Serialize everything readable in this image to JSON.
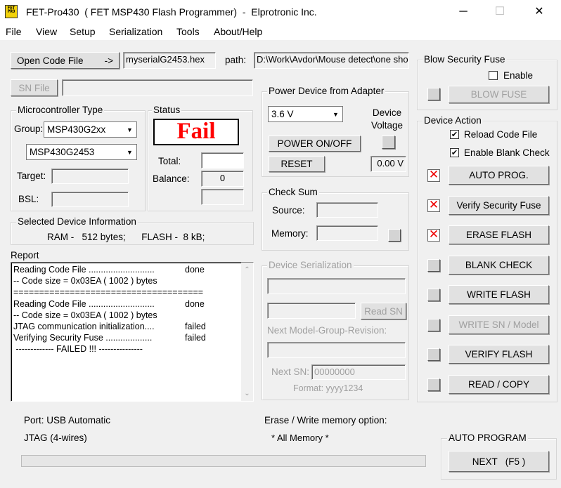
{
  "window": {
    "title": "FET-Pro430  ( FET MSP430 Flash Programmer)  -  Elprotronic Inc.",
    "icon_text": [
      "FET",
      "PRO"
    ],
    "minimize": "─",
    "maximize": "☐",
    "close": "✕"
  },
  "menu": [
    "File",
    "View",
    "Setup",
    "Serialization",
    "Tools",
    "About/Help"
  ],
  "code_file": {
    "open_button": "Open Code File        ->",
    "filename": "myserialG2453.hex",
    "path_label": "path:",
    "path_value": "D:\\Work\\Avdor\\Mouse detect\\one shot\\",
    "sn_file_button": "SN File",
    "sn_file_value": ""
  },
  "microcontroller": {
    "title": "Microcontroller Type",
    "group_label": "Group:",
    "group_value": "MSP430G2xx",
    "device_value": "MSP430G2453",
    "target_label": "Target:",
    "bsl_label": "BSL:"
  },
  "status": {
    "title": "Status",
    "result": "Fail",
    "total_label": "Total:",
    "total_value": "",
    "balance_label": "Balance:",
    "balance_value": "0"
  },
  "power": {
    "title": "Power Device from Adapter",
    "voltage_select": "3.6 V",
    "device_voltage_label": "Device\nVoltage",
    "power_button": "POWER ON/OFF",
    "reset_button": "RESET",
    "measured_voltage": "0.00 V"
  },
  "selected_device": {
    "title": "Selected Device Information",
    "info": "RAM -   512 bytes;      FLASH -  8 kB;"
  },
  "checksum": {
    "title": "Check Sum",
    "source_label": "Source:",
    "memory_label": "Memory:"
  },
  "report": {
    "title": "Report",
    "lines": [
      {
        "text": "Reading Code File ...........................",
        "status": "done"
      },
      {
        "text": "-- Code size = 0x03EA ( 1002 ) bytes",
        "status": ""
      },
      {
        "text": "=====================================",
        "status": ""
      },
      {
        "text": "Reading Code File ...........................",
        "status": "done"
      },
      {
        "text": "-- Code size = 0x03EA ( 1002 ) bytes",
        "status": ""
      },
      {
        "text": "JTAG communication initialization....",
        "status": "failed"
      },
      {
        "text": "Verifying Security Fuse ...................",
        "status": "failed"
      },
      {
        "text": " ------------- FAILED !!! ---------------",
        "status": ""
      }
    ]
  },
  "serialization": {
    "title": "Device Serialization",
    "read_sn_button": "Read SN",
    "next_model_label": "Next Model-Group-Revision:",
    "next_sn_label": "Next SN:",
    "next_sn_value": "00000000",
    "format_label": "Format: yyyy1234"
  },
  "security_fuse": {
    "title": "Blow Security Fuse",
    "enable_label": "Enable",
    "enable_checked": false,
    "blow_button": "BLOW FUSE"
  },
  "device_action": {
    "title": "Device Action",
    "reload_label": "Reload Code File",
    "reload_checked": true,
    "blank_check_label": "Enable Blank Check",
    "blank_check_checked": true,
    "check_mark": "✔",
    "fail_mark": "✕",
    "actions": [
      {
        "label": "AUTO PROG.",
        "state": "failed",
        "enabled": true
      },
      {
        "label": "Verify Security Fuse",
        "state": "failed",
        "enabled": true
      },
      {
        "label": "ERASE FLASH",
        "state": "failed",
        "enabled": true
      },
      {
        "label": "BLANK CHECK",
        "state": "idle",
        "enabled": true
      },
      {
        "label": "WRITE FLASH",
        "state": "idle",
        "enabled": true
      },
      {
        "label": "WRITE SN / Model",
        "state": "idle",
        "enabled": false
      },
      {
        "label": "VERIFY FLASH",
        "state": "idle",
        "enabled": true
      },
      {
        "label": "READ / COPY",
        "state": "idle",
        "enabled": true
      }
    ]
  },
  "footer": {
    "port": "Port: USB Automatic",
    "jtag": "JTAG (4-wires)",
    "erase_option_label": "Erase / Write memory option:",
    "erase_option_value": "* All Memory *",
    "progress": 0,
    "auto_program_title": "AUTO PROGRAM",
    "next_button": "NEXT   (F5 )"
  },
  "colors": {
    "fail_red": "#ff0000",
    "window_bg": "#f0f0f0",
    "icon_yellow": "#f2d20a"
  }
}
